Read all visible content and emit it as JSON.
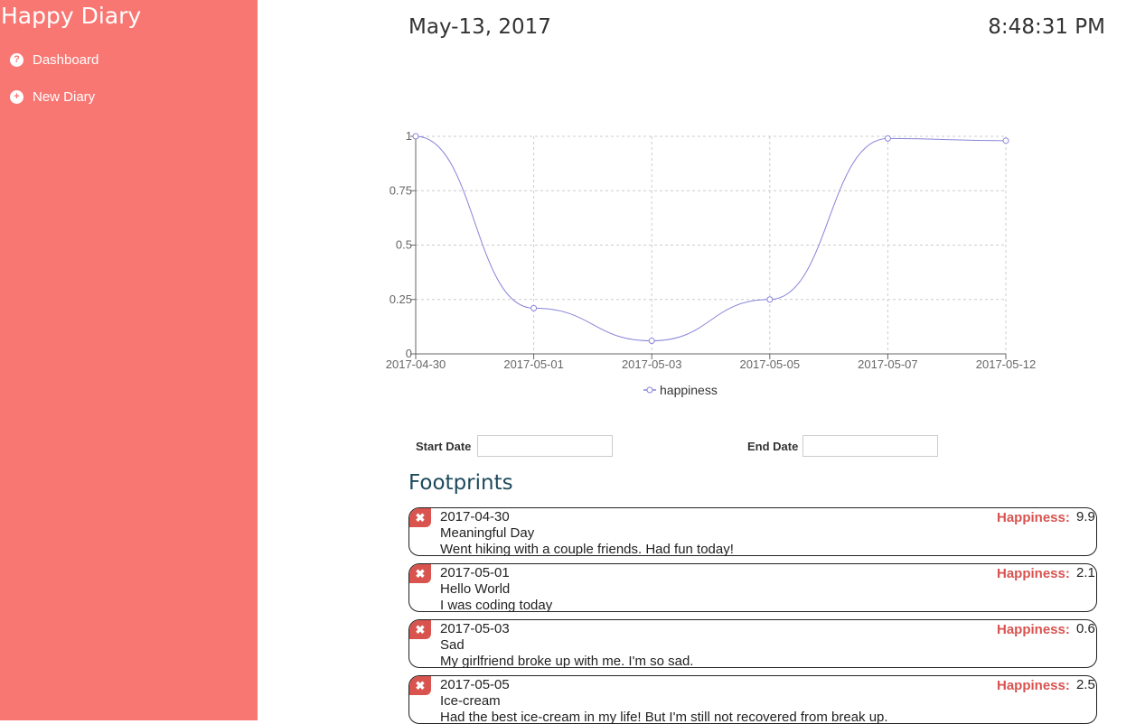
{
  "sidebar": {
    "brand": "Happy Diary",
    "items": [
      {
        "label": "Dashboard",
        "icon": "question-circle-icon"
      },
      {
        "label": "New Diary",
        "icon": "plus-circle-icon"
      }
    ]
  },
  "header": {
    "date": "May-13, 2017",
    "time": "8:48:31 PM"
  },
  "chart_data": {
    "type": "line",
    "categories": [
      "2017-04-30",
      "2017-05-01",
      "2017-05-03",
      "2017-05-05",
      "2017-05-07",
      "2017-05-12"
    ],
    "series": [
      {
        "name": "happiness",
        "values": [
          1.0,
          0.21,
          0.06,
          0.25,
          0.99,
          0.98
        ],
        "color": "#8884d8"
      }
    ],
    "yticks": [
      "0",
      "0.25",
      "0.5",
      "0.75",
      "1"
    ],
    "ylim": [
      0,
      1
    ],
    "grid": true,
    "legend": "bottom"
  },
  "filters": {
    "start_label": "Start Date",
    "start_value": "",
    "end_label": "End Date",
    "end_value": ""
  },
  "footprints": {
    "title": "Footprints",
    "happiness_label": "Happiness:",
    "entries": [
      {
        "date": "2017-04-30",
        "title": "Meaningful Day",
        "body": "Went hiking with a couple friends. Had fun today!",
        "happiness": "9.9"
      },
      {
        "date": "2017-05-01",
        "title": "Hello World",
        "body": "I was coding today",
        "happiness": "2.1"
      },
      {
        "date": "2017-05-03",
        "title": "Sad",
        "body": "My girlfriend broke up with me. I'm so sad.",
        "happiness": "0.6"
      },
      {
        "date": "2017-05-05",
        "title": "Ice-cream",
        "body": "Had the best ice-cream in my life! But I'm still not recovered from break up.",
        "happiness": "2.5"
      }
    ]
  }
}
